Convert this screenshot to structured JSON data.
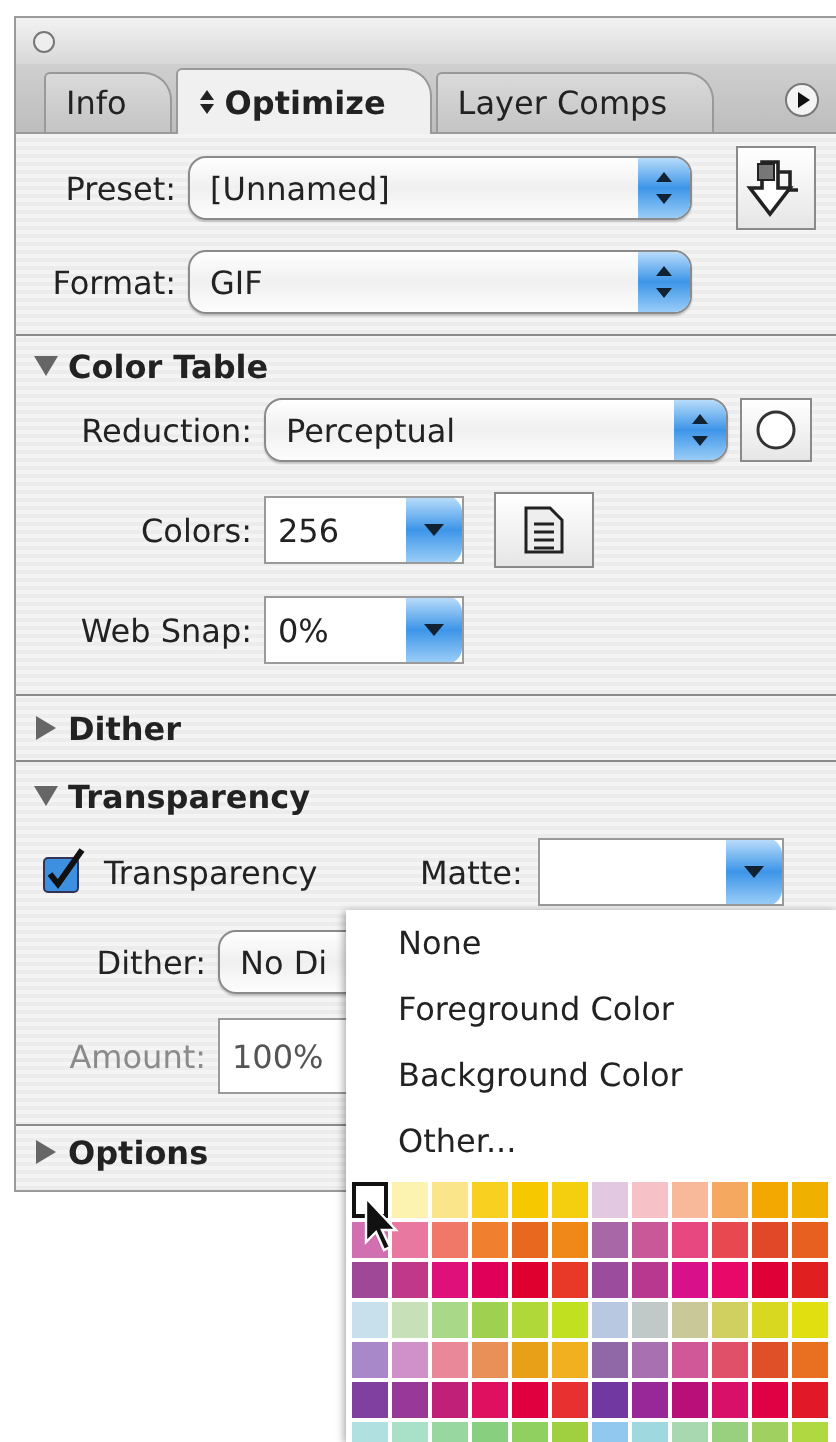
{
  "tabs": [
    {
      "label": "Info",
      "selected": false,
      "sortable": false
    },
    {
      "label": "Optimize",
      "selected": true,
      "sortable": true
    },
    {
      "label": "Layer Comps",
      "selected": false,
      "sortable": false
    }
  ],
  "preset": {
    "label": "Preset:",
    "value": "[Unnamed]"
  },
  "format": {
    "label": "Format:",
    "value": "GIF"
  },
  "color_table": {
    "title": "Color Table",
    "expanded": true,
    "reduction": {
      "label": "Reduction:",
      "value": "Perceptual"
    },
    "colors": {
      "label": "Colors:",
      "value": "256"
    },
    "web_snap": {
      "label": "Web Snap:",
      "value": "0%"
    }
  },
  "dither_section": {
    "title": "Dither",
    "expanded": false
  },
  "transparency": {
    "title": "Transparency",
    "expanded": true,
    "checkbox": {
      "label": "Transparency",
      "checked": true
    },
    "matte": {
      "label": "Matte:"
    },
    "dither": {
      "label": "Dither:",
      "value": "No Di"
    },
    "amount": {
      "label": "Amount:",
      "value": "100%",
      "disabled": true
    }
  },
  "options_section": {
    "title": "Options",
    "expanded": false
  },
  "matte_menu": {
    "items": [
      {
        "label": "None"
      },
      {
        "label": "Foreground Color"
      },
      {
        "label": "Background Color"
      },
      {
        "label": "Other..."
      }
    ],
    "swatch_rows": [
      {
        "swatches": [
          {
            "color": "#ffffff",
            "selected": true
          },
          {
            "color": "#fdf3b0",
            "selected": false
          },
          {
            "color": "#fbe58a",
            "selected": false
          },
          {
            "color": "#f7d020",
            "selected": false
          },
          {
            "color": "#f5c800",
            "selected": false
          },
          {
            "color": "#f4cf10",
            "selected": false
          },
          {
            "color": "#e2c8e0",
            "selected": false
          },
          {
            "color": "#f6c2c8",
            "selected": false
          },
          {
            "color": "#f8b89a",
            "selected": false
          },
          {
            "color": "#f5a860",
            "selected": false
          },
          {
            "color": "#f2a800",
            "selected": false
          },
          {
            "color": "#f0b000",
            "selected": false
          }
        ]
      },
      {
        "swatches": [
          {
            "color": "#d070b0",
            "selected": false
          },
          {
            "color": "#e878a0",
            "selected": false
          },
          {
            "color": "#f07868",
            "selected": false
          },
          {
            "color": "#f08030",
            "selected": false
          },
          {
            "color": "#e86820",
            "selected": false
          },
          {
            "color": "#f08818",
            "selected": false
          },
          {
            "color": "#a868a8",
            "selected": false
          },
          {
            "color": "#c85898",
            "selected": false
          },
          {
            "color": "#e84880",
            "selected": false
          },
          {
            "color": "#e84850",
            "selected": false
          },
          {
            "color": "#e04828",
            "selected": false
          },
          {
            "color": "#e86020",
            "selected": false
          }
        ]
      },
      {
        "swatches": [
          {
            "color": "#a04898",
            "selected": false
          },
          {
            "color": "#c03888",
            "selected": false
          },
          {
            "color": "#e0107a",
            "selected": false
          },
          {
            "color": "#e0005a",
            "selected": false
          },
          {
            "color": "#e00030",
            "selected": false
          },
          {
            "color": "#e83828",
            "selected": false
          },
          {
            "color": "#9c4c9c",
            "selected": false
          },
          {
            "color": "#b83890",
            "selected": false
          },
          {
            "color": "#d8108a",
            "selected": false
          },
          {
            "color": "#e80868",
            "selected": false
          },
          {
            "color": "#e00038",
            "selected": false
          },
          {
            "color": "#e02020",
            "selected": false
          }
        ]
      },
      {
        "swatches": [
          {
            "color": "#c8e0ec",
            "selected": false
          },
          {
            "color": "#c8e0b8",
            "selected": false
          },
          {
            "color": "#a8d888",
            "selected": false
          },
          {
            "color": "#a0d050",
            "selected": false
          },
          {
            "color": "#b0d838",
            "selected": false
          },
          {
            "color": "#c0e020",
            "selected": false
          },
          {
            "color": "#b8c8e0",
            "selected": false
          },
          {
            "color": "#c0c8c8",
            "selected": false
          },
          {
            "color": "#c8c898",
            "selected": false
          },
          {
            "color": "#d0d060",
            "selected": false
          },
          {
            "color": "#d8d820",
            "selected": false
          },
          {
            "color": "#e0e010",
            "selected": false
          }
        ]
      },
      {
        "swatches": [
          {
            "color": "#a888c8",
            "selected": false
          },
          {
            "color": "#d090c8",
            "selected": false
          },
          {
            "color": "#e88898",
            "selected": false
          },
          {
            "color": "#e89058",
            "selected": false
          },
          {
            "color": "#e8a018",
            "selected": false
          },
          {
            "color": "#f0b020",
            "selected": false
          },
          {
            "color": "#9068a8",
            "selected": false
          },
          {
            "color": "#a870b0",
            "selected": false
          },
          {
            "color": "#d05898",
            "selected": false
          },
          {
            "color": "#e05068",
            "selected": false
          },
          {
            "color": "#e05028",
            "selected": false
          },
          {
            "color": "#e87020",
            "selected": false
          }
        ]
      },
      {
        "swatches": [
          {
            "color": "#8040a0",
            "selected": false
          },
          {
            "color": "#983898",
            "selected": false
          },
          {
            "color": "#c02078",
            "selected": false
          },
          {
            "color": "#e01060",
            "selected": false
          },
          {
            "color": "#e00040",
            "selected": false
          },
          {
            "color": "#e83030",
            "selected": false
          },
          {
            "color": "#7038a0",
            "selected": false
          },
          {
            "color": "#982898",
            "selected": false
          },
          {
            "color": "#b81078",
            "selected": false
          },
          {
            "color": "#d81068",
            "selected": false
          },
          {
            "color": "#e00044",
            "selected": false
          },
          {
            "color": "#e01828",
            "selected": false
          }
        ]
      },
      {
        "swatches": [
          {
            "color": "#b0e0e0",
            "selected": false
          },
          {
            "color": "#a8e0c8",
            "selected": false
          },
          {
            "color": "#98d8a0",
            "selected": false
          },
          {
            "color": "#88d080",
            "selected": false
          },
          {
            "color": "#90d060",
            "selected": false
          },
          {
            "color": "#a0d040",
            "selected": false
          },
          {
            "color": "#90c8f0",
            "selected": false
          },
          {
            "color": "#a0d8e0",
            "selected": false
          },
          {
            "color": "#a8d8b0",
            "selected": false
          },
          {
            "color": "#98d080",
            "selected": false
          },
          {
            "color": "#a0d060",
            "selected": false
          },
          {
            "color": "#b0d840",
            "selected": false
          }
        ]
      }
    ]
  }
}
